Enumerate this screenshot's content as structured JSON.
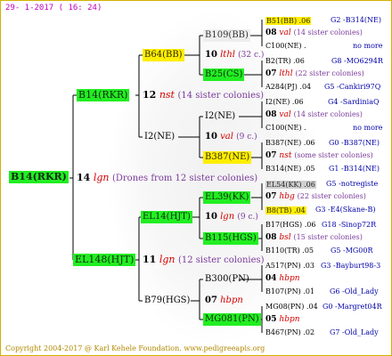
{
  "header": {
    "date": "29-  1-2017  ( 16: 24)"
  },
  "footer": {
    "copyright": "Copyright 2004-2017 @ Karl Kehele Foundation.   www.pedigreeapis.org"
  },
  "root": {
    "label": "B14(RKR)",
    "mating_num": "14",
    "mating_code": "lgn",
    "mating_note": "(Drones from 12 sister colonies)"
  },
  "dam": {
    "label": "B14(RKR)",
    "num": "12",
    "code": "nst",
    "note": "(14 sister colonies)"
  },
  "sire": {
    "label": "EL148(HJT)",
    "num": "11",
    "code": "lgn",
    "note": "(12 sister colonies)"
  },
  "g3": {
    "b64": {
      "label": "B64(BB)",
      "num": "10",
      "code": "lthl",
      "note": "(32 c.)"
    },
    "i2": {
      "label": "I2(NE)",
      "num": "10",
      "code": "val",
      "note": "(9 c.)"
    },
    "el14": {
      "label": "EL14(HJT)",
      "num": "10",
      "code": "lgn",
      "note": "(9 c.)"
    },
    "b79": {
      "label": "B79(HGS)",
      "num": "07",
      "code": "hbpn"
    }
  },
  "g4": {
    "b109": "B109(BB)",
    "b25": "B25(CS)",
    "i2ne": "I2(NE)",
    "b387": "B387(NE)",
    "el39": "EL39(KK)",
    "b115": "B115(HGS)",
    "b300": "B300(PN)",
    "mg081": "MG081(PN)"
  },
  "g5": [
    {
      "top": "B51(BB) .06",
      "top_ref": "G2 -B314(NE)",
      "num": "08",
      "code": "val",
      "note": "(14 sister colonies)",
      "bot": "C100(NE) .",
      "bot_ref": "no more"
    },
    {
      "top": "B2(TR) .06",
      "top_ref": "G8 -MO6294R",
      "num": "07",
      "code": "lthl",
      "note": "(22 sister colonies)",
      "bot": "A284(PJ) .04",
      "bot_ref": "G5 -Cankiri97Q"
    },
    {
      "top": "I2(NE) .06",
      "top_ref": "G4 -SardiniaQ",
      "num": "08",
      "code": "val",
      "note": "(14 sister colonies)",
      "bot": "C100(NE) .",
      "bot_ref": "no more"
    },
    {
      "top": "B387(NE) .06",
      "top_ref": "G0 -B387(NE)",
      "num": "07",
      "code": "nst",
      "note": "(some sister colonies)",
      "bot": "B314(NE) .05",
      "bot_ref": "G1 -B314(NE)"
    },
    {
      "top": "EL54(KK) .06",
      "top_ref": "G5 -notregiste",
      "num": "07",
      "code": "hbg",
      "note": "(22 sister colonies)",
      "bot": "B8(TB) .04",
      "bot_ref": "G3 -E4(Skane-B)"
    },
    {
      "top": "B17(HGS) .06",
      "top_ref": "G18 -Sinop72R",
      "num": "08",
      "code": "bsl",
      "note": "(15 sister colonies)",
      "bot": "B110(TR) .05",
      "bot_ref": "G5 -MG00R"
    },
    {
      "top": "A517(PN) .03",
      "top_ref": "G3 -Bayburt98-3",
      "num": "04",
      "code": "hbpn",
      "note": "",
      "bot": "B107(PN) .01",
      "bot_ref": "G6 -Old_Lady"
    },
    {
      "top": "MG08(PN) .04",
      "top_ref": "G0 -Margret04R",
      "num": "05",
      "code": "hbpn",
      "note": "",
      "bot": "B467(PN) .02",
      "bot_ref": "G7 -Old_Lady"
    }
  ],
  "colors": {
    "green": "#22ee22",
    "yellow": "#ffee00",
    "red": "#d40000",
    "blue": "#0000aa",
    "purple": "#7a3b9a",
    "frame": "#d4b000"
  }
}
